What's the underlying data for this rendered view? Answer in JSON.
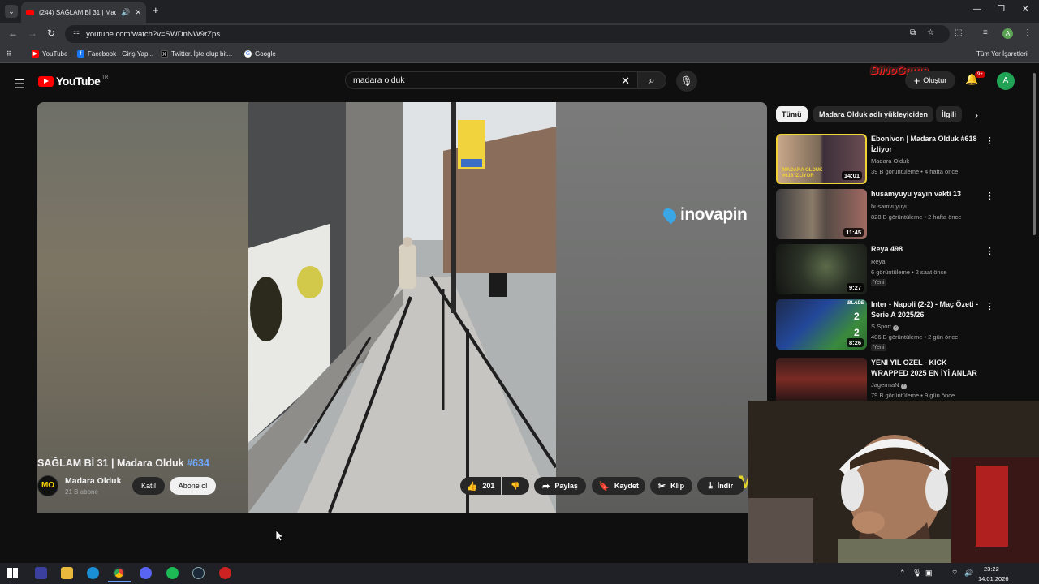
{
  "browser": {
    "tab_title": "(244) SAĞLAM Bİ 31 | Mada",
    "url": "youtube.com/watch?v=SWDnNW9rZps",
    "bookmarks": [
      {
        "label": "YouTube"
      },
      {
        "label": "Facebook - Giriş Yap..."
      },
      {
        "label": "Twitter. İşte olup bit..."
      },
      {
        "label": "Google"
      }
    ],
    "other_bookmarks": "Tüm Yer İşaretleri"
  },
  "youtube": {
    "logo_text": "YouTube",
    "logo_region": "TR",
    "search_value": "madara olduk",
    "create_label": "Oluştur",
    "notif_count": "9+",
    "avatar_letter": "A",
    "watermark": "BiNoGame"
  },
  "player": {
    "overlay_brand": "inovapin",
    "corner_mark": "M"
  },
  "video": {
    "title": "SAĞLAM Bİ 31 | Madara Olduk",
    "hashtag": "#634",
    "channel_avatar": "MO",
    "channel": "Madara Olduk",
    "subscribers": "21 B abone",
    "join_label": "Katıl",
    "subscribe_label": "Abone ol",
    "likes": "201",
    "share_label": "Paylaş",
    "save_label": "Kaydet",
    "clip_label": "Klip",
    "download_label": "İndir"
  },
  "chips": [
    "Tümü",
    "Madara Olduk adlı yükleyiciden",
    "İlgili"
  ],
  "recommendations": [
    {
      "title": "Ebonivon | Madara Olduk #618 İzliyor",
      "channel": "Madara Olduk",
      "meta": "39 B görüntüleme • 4 hafta önce",
      "duration": "14:01",
      "verified": false,
      "new": ""
    },
    {
      "title": "husamyuyu yayın vakti 13",
      "channel": "husamvuyuyu",
      "meta": "828 B görüntüleme • 2 hafta önce",
      "duration": "11:45",
      "verified": false,
      "new": ""
    },
    {
      "title": "Reya 498",
      "channel": "Reya",
      "meta": "6 görüntüleme • 2 saat önce",
      "duration": "9:27",
      "verified": false,
      "new": "Yeni"
    },
    {
      "title": "Inter - Napoli (2-2) - Maç Özeti - Serie A 2025/26",
      "channel": "S Sport",
      "meta": "406 B görüntüleme • 2 gün önce",
      "duration": "8:26",
      "verified": true,
      "new": "Yeni"
    },
    {
      "title": "YENİ YIL ÖZEL - KİCK WRAPPED 2025 EN İYİ ANLAR",
      "channel": "JagermaN",
      "meta": "79 B görüntüleme • 9 gün önce",
      "duration": "",
      "verified": true,
      "new": ""
    }
  ],
  "thumb_texts": {
    "rec1": "MADARA OLDUK #618 İZLİYOR",
    "rec4_brand": "BLADE",
    "rec4_score_a": "2",
    "rec4_score_b": "2"
  },
  "taskbar": {
    "time": "23:22",
    "date": "14.01.2026"
  },
  "colors": {
    "yt_red": "#ff0000",
    "background": "#0f0f0f",
    "hashtag": "#6ea8ff"
  }
}
